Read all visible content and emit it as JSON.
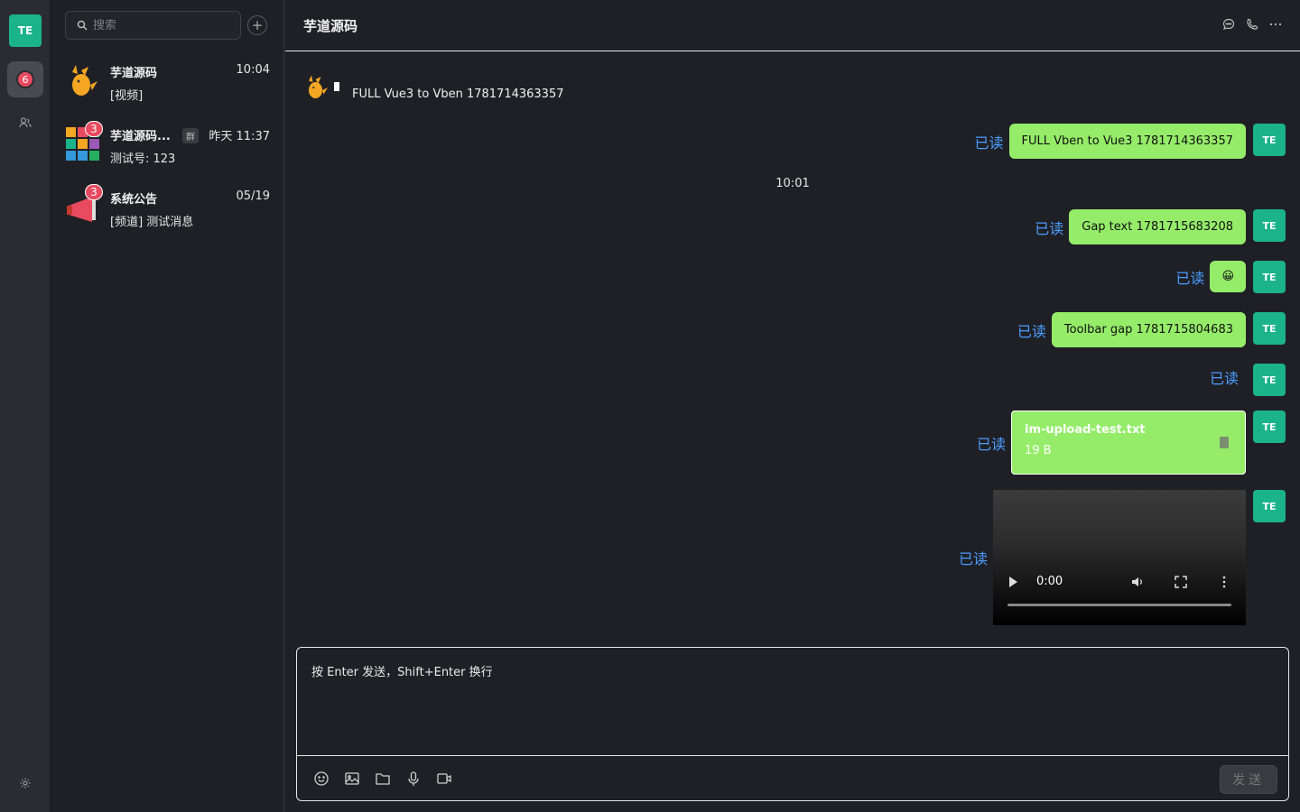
{
  "rail": {
    "avatar": "TE",
    "unread_badge": "6",
    "items": [
      "chat-icon",
      "contacts-icon",
      "settings-icon"
    ]
  },
  "sidebar": {
    "search_placeholder": "搜索",
    "add_label": "+",
    "conversations": [
      {
        "name": "芋道源码",
        "time": "10:04",
        "preview": "[视频]",
        "badge": "",
        "tag": ""
      },
      {
        "name": "芋道源码...",
        "time": "昨天 11:37",
        "preview": "测试号: 123",
        "badge": "3",
        "tag": "群"
      },
      {
        "name": "系统公告",
        "time": "05/19",
        "preview": "[频道] 测试消息",
        "badge": "3",
        "tag": ""
      }
    ]
  },
  "chat": {
    "title": "芋道源码",
    "messages": {
      "other_text": "FULL Vue3 to Vben 1781714363357",
      "read_label": "已读",
      "my_avatar": "TE",
      "bubble1": "FULL Vben to Vue3 1781714363357",
      "time_divider": "10:01",
      "bubble2": "Gap text 1781715683208",
      "bubble3": "😀",
      "bubble4": "Toolbar gap 1781715804683",
      "file_name": "im-upload-test.txt",
      "file_size": "19 B",
      "video_time": "0:00"
    }
  },
  "composer": {
    "placeholder": "按 Enter 发送，Shift+Enter 换行",
    "send_label": "发送"
  },
  "colors": {
    "accent": "#1bb38a",
    "bubble": "#95ec69",
    "read": "#4b9dff",
    "badge": "#e84a5f"
  }
}
